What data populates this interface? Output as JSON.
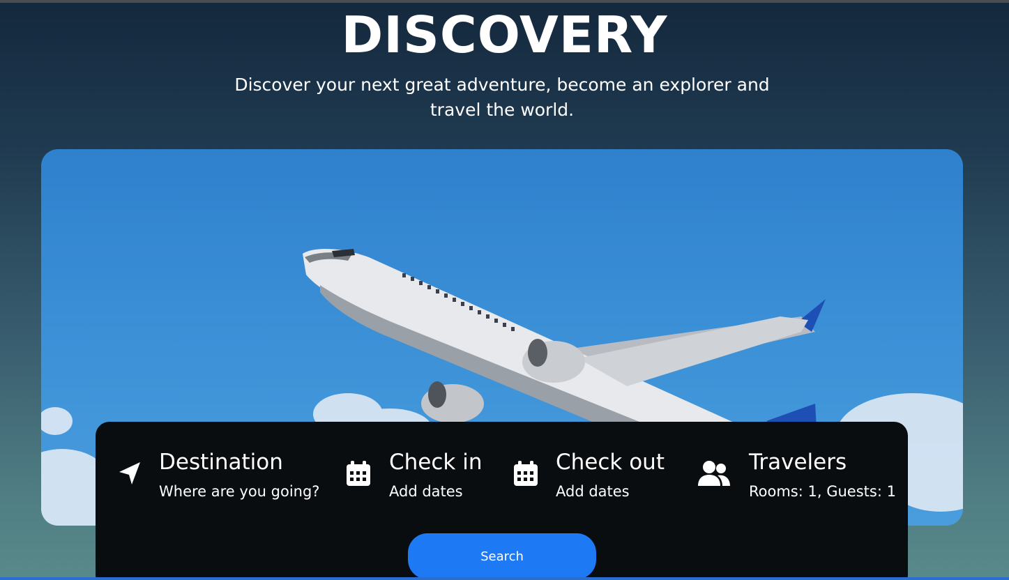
{
  "hero": {
    "title": "DISCOVERY",
    "subtitle": "Discover your next great adventure, become an explorer and travel the world."
  },
  "search_panel": {
    "destination": {
      "icon": "location-arrow-icon",
      "label": "Destination",
      "value": "Where are you going?"
    },
    "check_in": {
      "icon": "calendar-icon",
      "label": "Check in",
      "value": "Add dates"
    },
    "check_out": {
      "icon": "calendar-icon",
      "label": "Check out",
      "value": "Add dates"
    },
    "travelers": {
      "icon": "users-icon",
      "label": "Travelers",
      "value": "Rooms: 1, Guests: 1"
    },
    "search_label": "Search"
  },
  "colors": {
    "panel_bg": "#0a0d10",
    "accent": "#1e79f5",
    "sky": "#3a8fd6"
  }
}
